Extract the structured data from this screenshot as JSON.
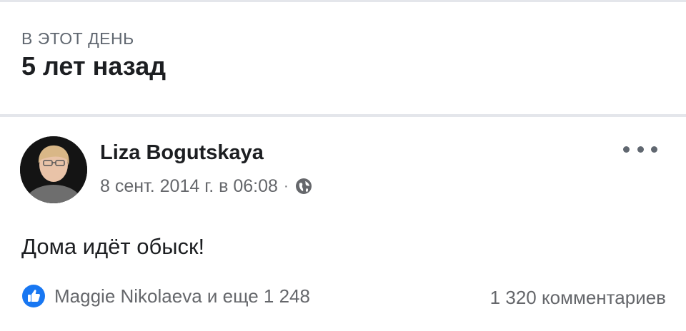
{
  "memory": {
    "kicker": "В ЭТОТ ДЕНЬ",
    "title": "5 лет назад"
  },
  "post": {
    "author": "Liza Bogutskaya",
    "date": "8 сент. 2014 г. в 06:08",
    "meta_separator": "·",
    "privacy_icon": "globe-icon",
    "more_icon": "more-horizontal-icon",
    "text": "Дома идёт обыск!"
  },
  "engagement": {
    "reaction_icon": "like-icon",
    "reactions_text": "Maggie Nikolaeva и еще 1 248",
    "comments_text": "1 320 комментариев"
  },
  "colors": {
    "primary_text": "#1c1e21",
    "secondary_text": "#65676b",
    "like_blue": "#1877f2",
    "divider": "#e4e6eb"
  }
}
